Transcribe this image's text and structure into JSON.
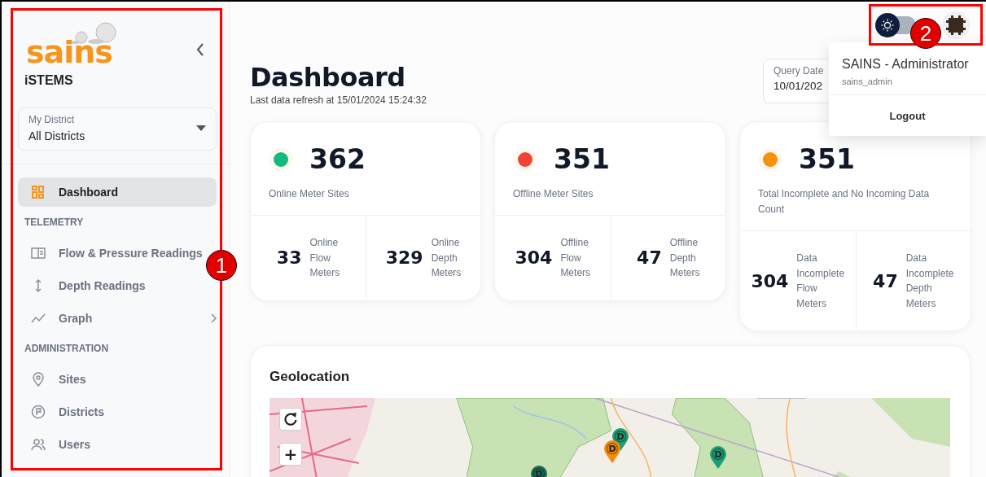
{
  "sidebar": {
    "brand": "sains",
    "app_name": "iSTEMS",
    "district_select": {
      "label": "My District",
      "value": "All Districts"
    },
    "items": [
      {
        "kind": "link",
        "label": "Dashboard",
        "selected": true
      },
      {
        "kind": "section",
        "label": "TELEMETRY"
      },
      {
        "kind": "link",
        "label": "Flow & Pressure Readings",
        "selected": false
      },
      {
        "kind": "link",
        "label": "Depth Readings",
        "selected": false
      },
      {
        "kind": "group",
        "label": "Graph",
        "selected": false,
        "expanded": false
      },
      {
        "kind": "section",
        "label": "ADMINISTRATION"
      },
      {
        "kind": "link",
        "label": "Sites",
        "selected": false
      },
      {
        "kind": "link",
        "label": "Districts",
        "selected": false
      },
      {
        "kind": "link",
        "label": "Users",
        "selected": false
      }
    ]
  },
  "header": {
    "page_title": "Dashboard",
    "refresh_note": "Last data refresh at 15/01/2024 15:24:32",
    "query_date": {
      "label": "Query Date",
      "value": "10/01/202"
    },
    "theme_toggle": {
      "on": false
    }
  },
  "user_menu": {
    "name": "SAINS - Administrator",
    "username": "sains_admin",
    "actions": [
      "Logout"
    ]
  },
  "stats": [
    {
      "value": "362",
      "label": "Online Meter Sites",
      "color": "#12b981",
      "breakdown": [
        {
          "value": "33",
          "label": "Online Flow Meters"
        },
        {
          "value": "329",
          "label": "Online Depth Meters"
        }
      ]
    },
    {
      "value": "351",
      "label": "Offline Meter Sites",
      "color": "#ef4335",
      "breakdown": [
        {
          "value": "304",
          "label": "Offline Flow Meters"
        },
        {
          "value": "47",
          "label": "Offline Depth Meters"
        }
      ]
    },
    {
      "value": "351",
      "label": "Total Incomplete and No Incoming Data Count",
      "color": "#f7900a",
      "breakdown": [
        {
          "value": "304",
          "label": "Data Incomplete Flow Meters"
        },
        {
          "value": "47",
          "label": "Data Incomplete Depth Meters"
        }
      ]
    }
  ],
  "geolocation": {
    "title": "Geolocation",
    "map": {
      "zoom_controls": [
        "+"
      ],
      "markers": [
        {
          "label": "D",
          "color": "#1e9e73"
        },
        {
          "label": "D",
          "color": "#f28c0a"
        },
        {
          "label": "D",
          "color": "#1e9e73"
        },
        {
          "label": "D",
          "color": "#1b6b55"
        }
      ]
    }
  },
  "annotations": [
    {
      "label": "1"
    },
    {
      "label": "2"
    }
  ]
}
